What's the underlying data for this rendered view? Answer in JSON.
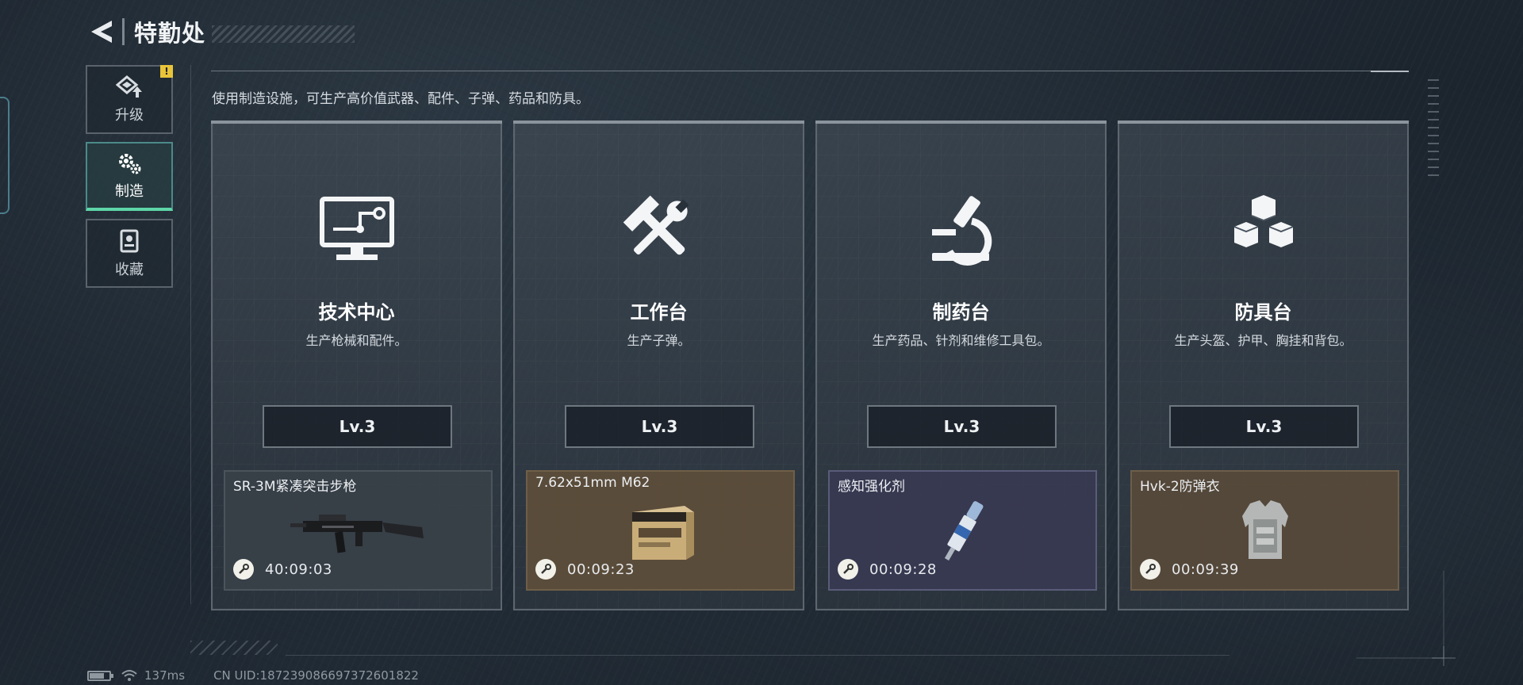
{
  "header": {
    "title": "特勤处",
    "back_icon": "back-arrow-icon"
  },
  "sidebar": {
    "items": [
      {
        "label": "升级",
        "icon": "upgrade-icon",
        "active": false,
        "badge": "!"
      },
      {
        "label": "制造",
        "icon": "gear-icon",
        "active": true
      },
      {
        "label": "收藏",
        "icon": "collection-icon",
        "active": false
      }
    ]
  },
  "description": "使用制造设施，可生产高价值武器、配件、子弹、药品和防具。",
  "cards": [
    {
      "icon": "monitor-circuit-icon",
      "title": "技术中心",
      "subtitle": "生产枪械和配件。",
      "level": "Lv.3",
      "product": {
        "name": "SR-3M紧凑突击步枪",
        "timer": "40:09:03",
        "image": "rifle-image",
        "tone": "grey"
      }
    },
    {
      "icon": "hammer-wrench-icon",
      "title": "工作台",
      "subtitle": "生产子弹。",
      "level": "Lv.3",
      "product": {
        "name": "7.62x51mm M62",
        "timer": "00:09:23",
        "image": "ammo-box-image",
        "tone": "brown"
      }
    },
    {
      "icon": "microscope-icon",
      "title": "制药台",
      "subtitle": "生产药品、针剂和维修工具包。",
      "level": "Lv.3",
      "product": {
        "name": "感知强化剂",
        "timer": "00:09:28",
        "image": "injector-image",
        "tone": "purple"
      }
    },
    {
      "icon": "armor-blocks-icon",
      "title": "防具台",
      "subtitle": "生产头盔、护甲、胸挂和背包。",
      "level": "Lv.3",
      "product": {
        "name": "Hvk-2防弹衣",
        "timer": "00:09:39",
        "image": "body-armor-image",
        "tone": "tan"
      }
    }
  ],
  "status_bar": {
    "battery_level": 0.7,
    "ping": "137ms",
    "uid": "CN UID:18723908669737260182​2"
  }
}
